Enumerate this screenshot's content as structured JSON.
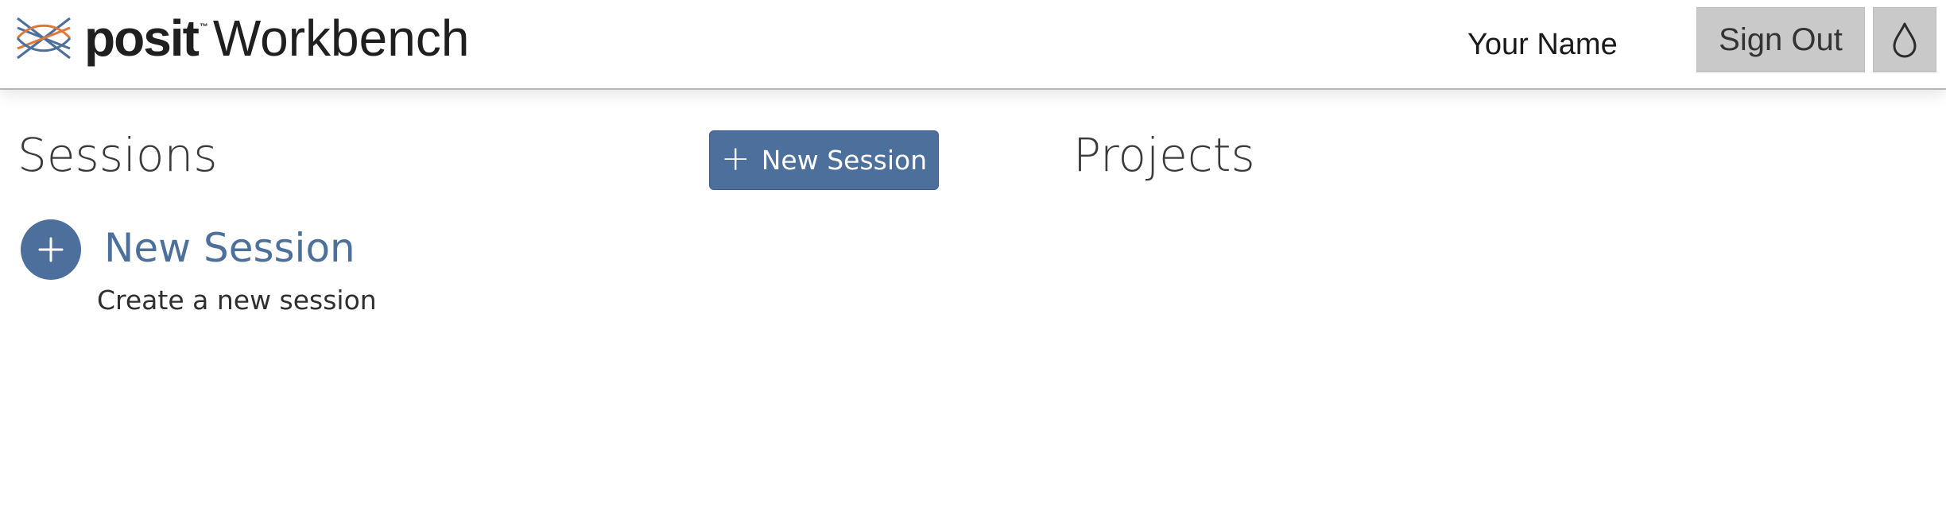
{
  "header": {
    "logo_word": "posit",
    "logo_tm": "™",
    "product_name": "Workbench",
    "user_name": "Your Name",
    "sign_out_label": "Sign Out",
    "theme_icon": "droplet-icon"
  },
  "main": {
    "sessions_title": "Sessions",
    "new_session_button_label": "New Session",
    "new_session_button_icon": "plus-icon",
    "projects_title": "Projects",
    "session_item": {
      "icon": "plus-circle-icon",
      "label": "New Session",
      "description": "Create a new session"
    }
  },
  "colors": {
    "accent": "#4c6f9b",
    "header_button_bg": "#c9c9c9",
    "logo_blue": "#4c6f9b",
    "logo_orange": "#e0773a"
  }
}
